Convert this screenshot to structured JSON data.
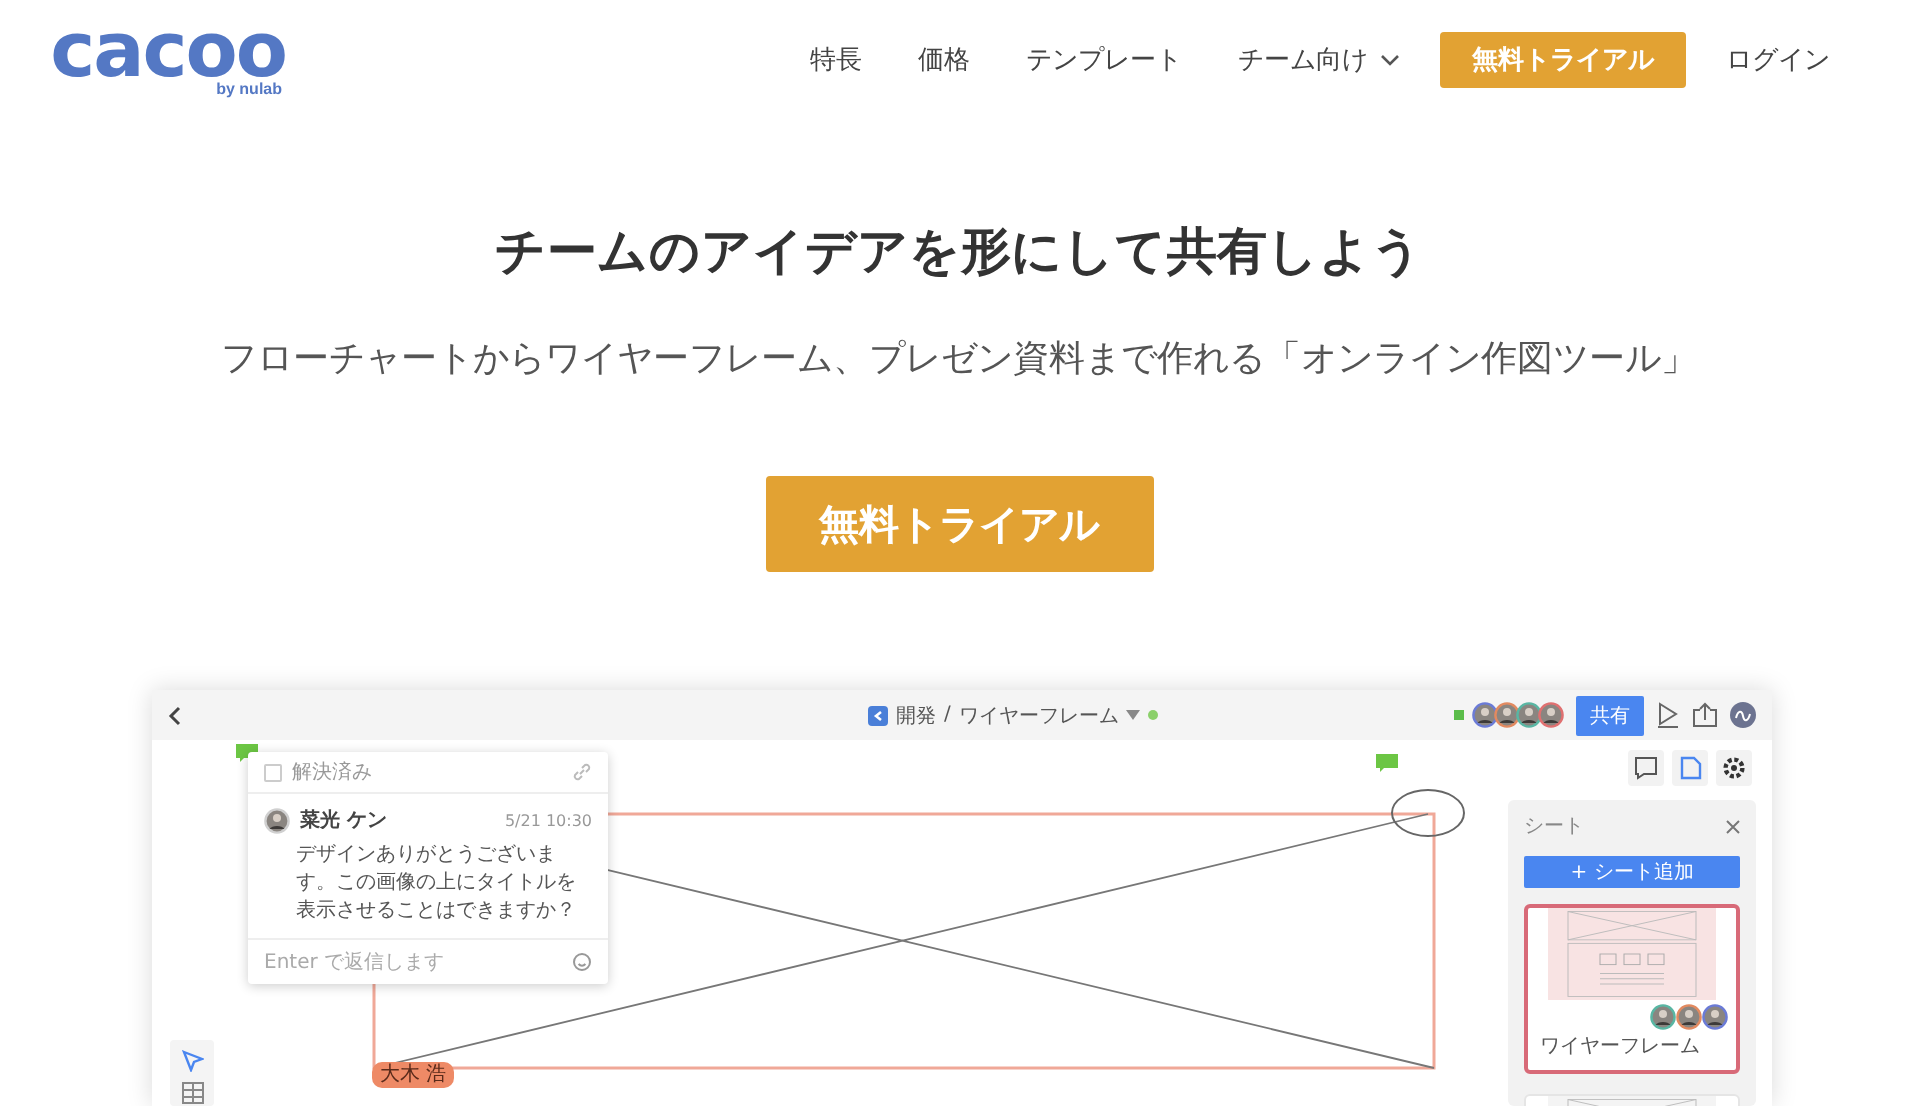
{
  "header": {
    "logo": "cacoo",
    "logo_sub": "by nulab",
    "nav": [
      {
        "label": "特長",
        "kind": "link"
      },
      {
        "label": "価格",
        "kind": "link"
      },
      {
        "label": "テンプレート",
        "kind": "link"
      },
      {
        "label": "チーム向け",
        "kind": "dropdown"
      },
      {
        "label": "無料トライアル",
        "kind": "button"
      },
      {
        "label": "ログイン",
        "kind": "link"
      }
    ]
  },
  "hero": {
    "title": "チームのアイデアを形にして共有しよう",
    "subtitle": "フローチャートからワイヤーフレーム、プレゼン資料まで作れる「オンライン作図ツール」",
    "cta": "無料トライアル"
  },
  "app_preview": {
    "toolbar": {
      "folder": "開発",
      "separator": "/",
      "document": "ワイヤーフレーム",
      "share_button": "共有"
    },
    "comment": {
      "resolved_label": "解決済み",
      "resolved": false,
      "author": "菜光 ケン",
      "time": "5/21 10:30",
      "message": "デザインありがとうございます。この画像の上にタイトルを表示させることはできますか？",
      "reply_placeholder": "Enter で返信します"
    },
    "selection_tag": "大木 浩",
    "sheets_panel": {
      "title": "シート",
      "add_button": "+ シート追加",
      "sheets": [
        {
          "name": "ワイヤーフレーム",
          "selected": true
        },
        {
          "selected": false
        }
      ]
    }
  }
}
